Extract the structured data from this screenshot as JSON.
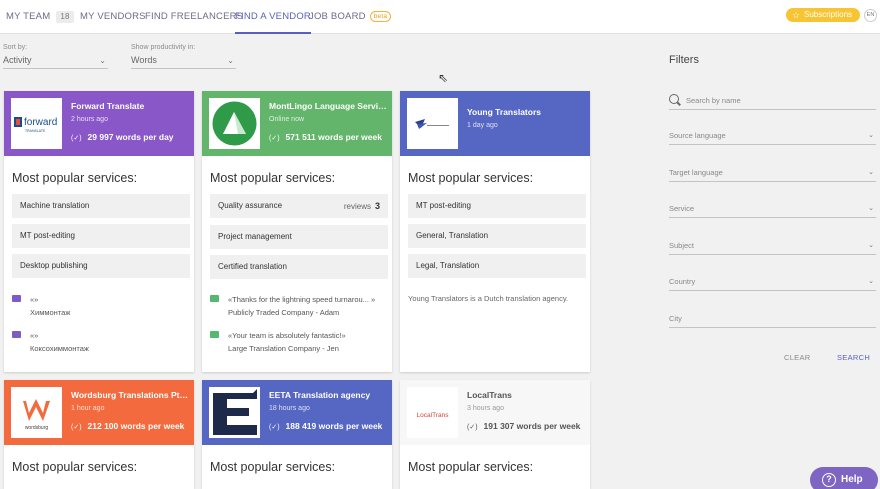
{
  "nav": {
    "my_team": "MY TEAM",
    "my_team_count": "18",
    "my_vendors": "MY VENDORS",
    "find_freelancers": "FIND FREELANCERS",
    "find_vendor": "FIND A VENDOR",
    "job_board": "JOB BOARD",
    "beta": "beta",
    "subscriptions": "Subscriptions",
    "lang": "EN"
  },
  "controls": {
    "sort_label": "Sort by:",
    "sort_value": "Activity",
    "productivity_label": "Show productivity in:",
    "productivity_value": "Words"
  },
  "cards": [
    {
      "name": "Forward Translate",
      "time": "2 hours ago",
      "words": "29 997 words per day",
      "popular": "Most popular services:",
      "services": [
        "Machine translation",
        "MT post-editing",
        "Desktop publishing"
      ],
      "comments": [
        {
          "text": "«»",
          "author": "Химмонтаж"
        },
        {
          "text": "«»",
          "author": "Коксохиммонтаж"
        }
      ],
      "color": "#8a57c9"
    },
    {
      "name": "MontLingo Language Servic...",
      "time": "Online now",
      "words": "571 511 words per week",
      "popular": "Most popular services:",
      "services": [
        "Quality assurance",
        "Project management",
        "Certified translation"
      ],
      "reviews_label": "reviews",
      "reviews_count": "3",
      "comments": [
        {
          "text": "«Thanks for the lightning speed turnarou... »",
          "author": "Publicly Traded Company - Adam"
        },
        {
          "text": "«Your team is absolutely fantastic!»",
          "author": "Large Translation Company - Jen"
        }
      ],
      "color": "#63b56c"
    },
    {
      "name": "Young Translators",
      "time": "1 day ago",
      "popular": "Most popular services:",
      "services": [
        "MT post-editing",
        "General, Translation",
        "Legal, Translation"
      ],
      "description": "Young Translators is a Dutch translation agency.",
      "color": "#5666c3"
    },
    {
      "name": "Wordsburg Translations Pte ...",
      "time": "1 hour ago",
      "words": "212 100 words per week",
      "popular": "Most popular services:",
      "logo_text": "wordsburg",
      "color": "#f26a3d"
    },
    {
      "name": "EETA Translation agency",
      "time": "18 hours ago",
      "words": "188 419 words per week",
      "popular": "Most popular services:",
      "color": "#5666c3"
    },
    {
      "name": "LocalTrans",
      "time": "3 hours ago",
      "words": "191 307 words per week",
      "popular": "Most popular services:",
      "logo_text": "LocalTrans",
      "color": "#f7f7f7"
    }
  ],
  "logo_texts": {
    "forward": "forward",
    "forward_sub": "TRANSLATE"
  },
  "filters": {
    "title": "Filters",
    "search_placeholder": "Search by name",
    "source_language": "Source language",
    "target_language": "Target language",
    "service": "Service",
    "subject": "Subject",
    "country": "Country",
    "city": "City",
    "clear": "CLEAR",
    "search": "SEARCH"
  },
  "help": "Help",
  "colors": {
    "accent": "#5a5fbf",
    "subscriptions": "#f7c433",
    "help": "#7e64c3"
  },
  "icons": {
    "chevron": "chevron-down-icon",
    "search": "search-icon",
    "star": "star-icon",
    "comment": "comment-icon",
    "words": "speed-icon"
  }
}
